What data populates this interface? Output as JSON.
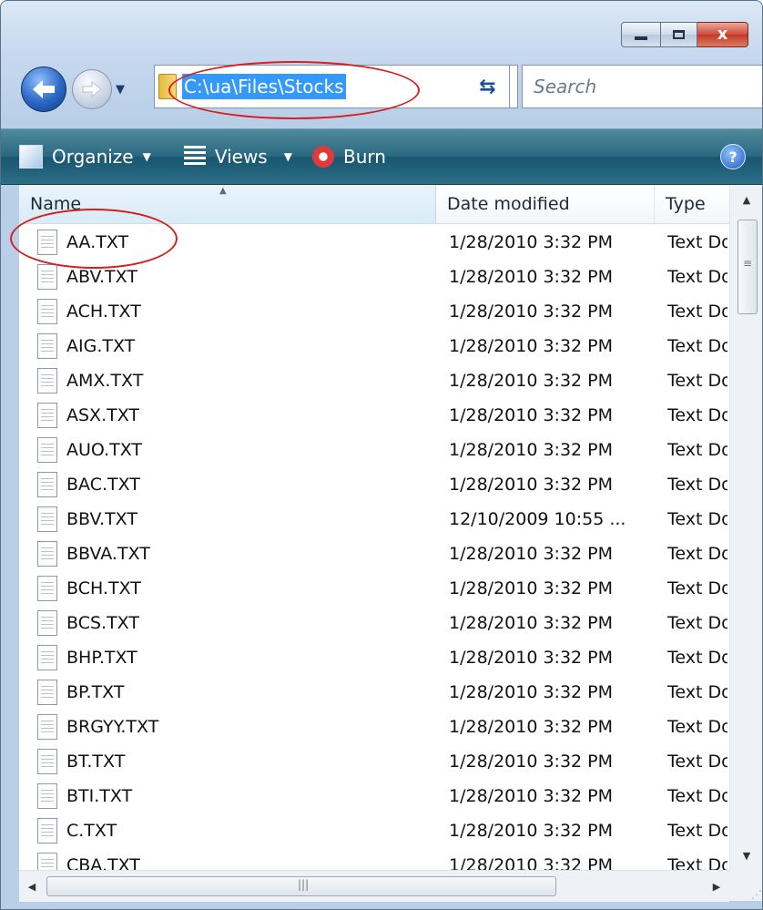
{
  "window": {
    "caption_buttons": {
      "minimize_icon": "minimize-icon",
      "maximize_icon": "maximize-icon",
      "close_icon": "close-icon",
      "close_glyph": "x"
    }
  },
  "nav": {
    "address_path": "C:\\ua\\Files\\Stocks",
    "search_placeholder": "Search"
  },
  "toolbar": {
    "organize_label": "Organize",
    "views_label": "Views",
    "burn_label": "Burn",
    "help_glyph": "?"
  },
  "columns": {
    "name": "Name",
    "date_modified": "Date modified",
    "type": "Type"
  },
  "files": [
    {
      "name": "AA.TXT",
      "date": "1/28/2010 3:32 PM",
      "type": "Text Document"
    },
    {
      "name": "ABV.TXT",
      "date": "1/28/2010 3:32 PM",
      "type": "Text Document"
    },
    {
      "name": "ACH.TXT",
      "date": "1/28/2010 3:32 PM",
      "type": "Text Document"
    },
    {
      "name": "AIG.TXT",
      "date": "1/28/2010 3:32 PM",
      "type": "Text Document"
    },
    {
      "name": "AMX.TXT",
      "date": "1/28/2010 3:32 PM",
      "type": "Text Document"
    },
    {
      "name": "ASX.TXT",
      "date": "1/28/2010 3:32 PM",
      "type": "Text Document"
    },
    {
      "name": "AUO.TXT",
      "date": "1/28/2010 3:32 PM",
      "type": "Text Document"
    },
    {
      "name": "BAC.TXT",
      "date": "1/28/2010 3:32 PM",
      "type": "Text Document"
    },
    {
      "name": "BBV.TXT",
      "date": "12/10/2009 10:55 ...",
      "type": "Text Document"
    },
    {
      "name": "BBVA.TXT",
      "date": "1/28/2010 3:32 PM",
      "type": "Text Document"
    },
    {
      "name": "BCH.TXT",
      "date": "1/28/2010 3:32 PM",
      "type": "Text Document"
    },
    {
      "name": "BCS.TXT",
      "date": "1/28/2010 3:32 PM",
      "type": "Text Document"
    },
    {
      "name": "BHP.TXT",
      "date": "1/28/2010 3:32 PM",
      "type": "Text Document"
    },
    {
      "name": "BP.TXT",
      "date": "1/28/2010 3:32 PM",
      "type": "Text Document"
    },
    {
      "name": "BRGYY.TXT",
      "date": "1/28/2010 3:32 PM",
      "type": "Text Document"
    },
    {
      "name": "BT.TXT",
      "date": "1/28/2010 3:32 PM",
      "type": "Text Document"
    },
    {
      "name": "BTI.TXT",
      "date": "1/28/2010 3:32 PM",
      "type": "Text Document"
    },
    {
      "name": "C.TXT",
      "date": "1/28/2010 3:32 PM",
      "type": "Text Document"
    },
    {
      "name": "CBA.TXT",
      "date": "1/28/2010 3:32 PM",
      "type": "Text Document"
    }
  ],
  "colors": {
    "selection": "#3399ff",
    "annotation": "#d5201f",
    "command_bar": "#2a6a82"
  }
}
